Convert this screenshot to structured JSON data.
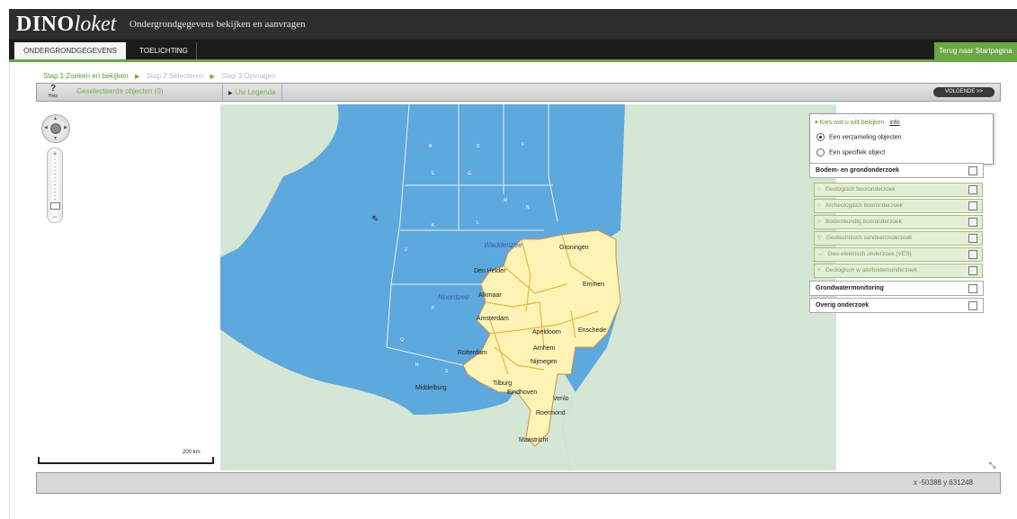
{
  "header": {
    "logo_bold": "DINO",
    "logo_italic": "loket",
    "subtitle": "Ondergrondgegevens bekijken en aanvragen"
  },
  "tabs": [
    {
      "label": "ONDERGRONDGEGEVENS",
      "active": true
    },
    {
      "label": "TOELICHTING",
      "active": false
    }
  ],
  "home_button": "Terug naar Startpagina",
  "steps": [
    "Stap 1:Zoeken en bekijken",
    "Stap 2:Selecteren",
    "Stap 3:Opvragen"
  ],
  "toolbar": {
    "help_symbol": "?",
    "help_label": "Help",
    "selected_objects": "Geselecteerde objecten (0)",
    "legend": "Uw Legenda",
    "next": "VOLGENDE >>"
  },
  "map": {
    "cities": [
      "Groningen",
      "Den Helder",
      "Alkmaar",
      "Emmen",
      "Amsterdam",
      "Apeldoorn",
      "Enschede",
      "Rotterdam",
      "Arnhem",
      "Nijmegen",
      "Middelburg",
      "Tilburg",
      "Eindhoven",
      "Venlo",
      "Roermond",
      "Maastricht"
    ],
    "seas": [
      "Waddenzee",
      "Noordzee"
    ],
    "grid_letters": [
      "B",
      "D",
      "F",
      "E",
      "G",
      "M",
      "L",
      "N",
      "K",
      "J",
      "P",
      "Q",
      "R",
      "S"
    ],
    "scale_label": "200 km",
    "colors": {
      "sea": "#5da8dc",
      "land": "#d4e7d4",
      "country": "#fcf3b4",
      "roads": "#e8b840"
    }
  },
  "status": {
    "coords": "x -50388  y 631248"
  },
  "view_panel": {
    "title": "Kies wat u wilt bekijken",
    "link": "info",
    "options": [
      {
        "label": "Een verzameling objecten",
        "selected": true
      },
      {
        "label": "Een specifiek object",
        "selected": false
      }
    ]
  },
  "layers": {
    "bodem": "Bodem- en grondonderzoek",
    "sublayers": [
      {
        "icon": "○",
        "label": "Geologisch booronderzoek"
      },
      {
        "icon": "○",
        "label": "Archeologisch booronderzoek"
      },
      {
        "icon": "○",
        "label": "Bodemkundig booronderzoek"
      },
      {
        "icon": "▽",
        "label": "Geotechnisch sondeeronderzoek"
      },
      {
        "icon": "↔",
        "label": "Geo-elektrisch onderzoek (VES)"
      },
      {
        "icon": "+",
        "label": "Geologisch w aterbodemonderzoek"
      }
    ],
    "grondwater": "Grondwatermonitoring",
    "overig": "Overig onderzoek"
  }
}
